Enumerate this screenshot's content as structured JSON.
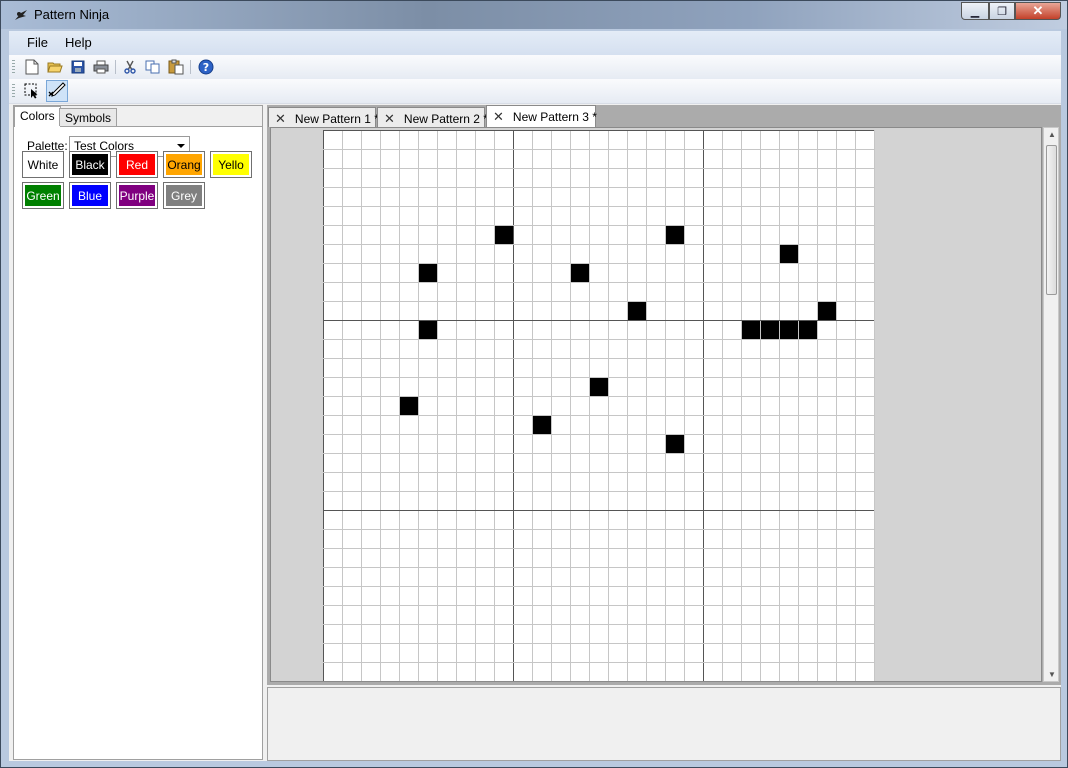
{
  "window": {
    "title": "Pattern Ninja"
  },
  "menu": [
    "File",
    "Help"
  ],
  "toolbar": {
    "buttons": [
      "new-icon",
      "open-icon",
      "save-icon",
      "print-icon",
      "cut-icon",
      "copy-icon",
      "paste-icon",
      "help-icon"
    ]
  },
  "tools": [
    "select-tool-icon",
    "pencil-tool-icon"
  ],
  "left_tabs": [
    {
      "label": "Colors",
      "active": true
    },
    {
      "label": "Symbols",
      "active": false
    }
  ],
  "palette": {
    "label": "Palette:",
    "selected": "Test Colors",
    "colors": [
      {
        "label": "White",
        "bg": "#ffffff",
        "fg": "#000000"
      },
      {
        "label": "Black",
        "bg": "#000000",
        "fg": "#ffffff"
      },
      {
        "label": "Red",
        "bg": "#ff0000",
        "fg": "#ffffff"
      },
      {
        "label": "Orang",
        "bg": "#ffa500",
        "fg": "#000000"
      },
      {
        "label": "Yello",
        "bg": "#ffff00",
        "fg": "#000000"
      },
      {
        "label": "Green",
        "bg": "#008000",
        "fg": "#ffffff"
      },
      {
        "label": "Blue",
        "bg": "#0000ff",
        "fg": "#ffffff"
      },
      {
        "label": "Purple",
        "bg": "#800080",
        "fg": "#ffffff"
      },
      {
        "label": "Grey",
        "bg": "#808080",
        "fg": "#ffffff"
      }
    ]
  },
  "doc_tabs": [
    {
      "label": "New Pattern 1 *",
      "active": false
    },
    {
      "label": "New Pattern 2 *",
      "active": false
    },
    {
      "label": "New Pattern 3 *",
      "active": true
    }
  ],
  "grid": {
    "columns": 29,
    "major_every": 10,
    "filled_color": "#000000",
    "filled_cells": [
      [
        9,
        5
      ],
      [
        18,
        5
      ],
      [
        24,
        6
      ],
      [
        5,
        7
      ],
      [
        13,
        7
      ],
      [
        16,
        9
      ],
      [
        26,
        9
      ],
      [
        5,
        10
      ],
      [
        22,
        10
      ],
      [
        23,
        10
      ],
      [
        24,
        10
      ],
      [
        25,
        10
      ],
      [
        14,
        13
      ],
      [
        4,
        14
      ],
      [
        11,
        15
      ],
      [
        18,
        16
      ]
    ]
  }
}
